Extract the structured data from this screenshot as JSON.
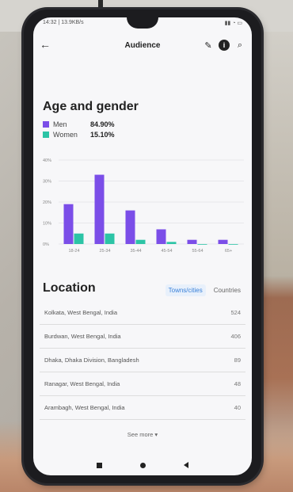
{
  "status": {
    "left": "14:32 | 13.9KB/s",
    "right": ""
  },
  "header": {
    "title": "Audience"
  },
  "age_gender": {
    "title": "Age and gender",
    "legend": [
      {
        "label": "Men",
        "value": "84.90%",
        "color": "#7b4ee8"
      },
      {
        "label": "Women",
        "value": "15.10%",
        "color": "#2cc4a6"
      }
    ]
  },
  "chart_data": {
    "type": "bar",
    "categories": [
      "18-24",
      "25-34",
      "35-44",
      "45-54",
      "55-64",
      "65+"
    ],
    "series": [
      {
        "name": "Men",
        "values": [
          19,
          33,
          16,
          7,
          2,
          2
        ]
      },
      {
        "name": "Women",
        "values": [
          5,
          5,
          2,
          1,
          0,
          0
        ]
      }
    ],
    "yticks": [
      "40%",
      "30%",
      "20%",
      "10%",
      "0%"
    ],
    "ylim": [
      0,
      40
    ],
    "colors": [
      "#7b4ee8",
      "#2cc4a6"
    ]
  },
  "location": {
    "title": "Location",
    "tabs": [
      {
        "label": "Towns/cities",
        "active": true
      },
      {
        "label": "Countries",
        "active": false
      }
    ],
    "rows": [
      {
        "place": "Kolkata, West Bengal, India",
        "count": "524"
      },
      {
        "place": "Burdwan, West Bengal, India",
        "count": "406"
      },
      {
        "place": "Dhaka, Dhaka Division, Bangladesh",
        "count": "89"
      },
      {
        "place": "Ranagar, West Bengal, India",
        "count": "48"
      },
      {
        "place": "Arambagh, West Bengal, India",
        "count": "40"
      }
    ],
    "see_more": "See more"
  }
}
